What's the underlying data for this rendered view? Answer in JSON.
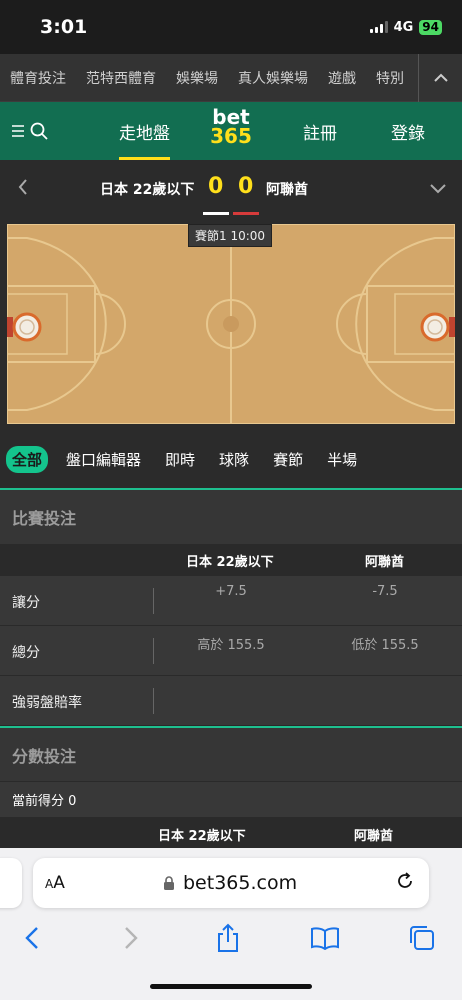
{
  "status_bar": {
    "time": "3:01",
    "network": "4G",
    "battery": "94"
  },
  "top_nav": {
    "items": [
      "體育投注",
      "范特西體育",
      "娛樂場",
      "真人娛樂場",
      "遊戲",
      "特別"
    ]
  },
  "header": {
    "tabs": {
      "live": "走地盤",
      "register": "註冊",
      "login": "登錄"
    },
    "logo_top": "bet",
    "logo_bottom": "365",
    "accent_color": "#ffdf1b",
    "brand_green": "#126e51"
  },
  "match": {
    "home": "日本 22歲以下",
    "away": "阿聯酋",
    "home_score": "0",
    "away_score": "0",
    "period": "賽節1  10:00"
  },
  "filters": [
    "全部",
    "盤口編輯器",
    "即時",
    "球隊",
    "賽節",
    "半場"
  ],
  "betting": {
    "title": "比賽投注",
    "col_home": "日本 22歲以下",
    "col_away": "阿聯酋",
    "rows": [
      {
        "label": "讓分",
        "home": "+7.5",
        "away": "-7.5"
      },
      {
        "label": "總分",
        "home": "高於 155.5",
        "away": "低於 155.5"
      },
      {
        "label": "強弱盤賠率",
        "home": "",
        "away": ""
      }
    ]
  },
  "points": {
    "title": "分數投注",
    "current_score": "當前得分 0",
    "col_home": "日本 22歲以下",
    "col_away": "阿聯酋"
  },
  "safari": {
    "aa_small": "A",
    "aa_large": "A",
    "url": "bet365.com"
  }
}
